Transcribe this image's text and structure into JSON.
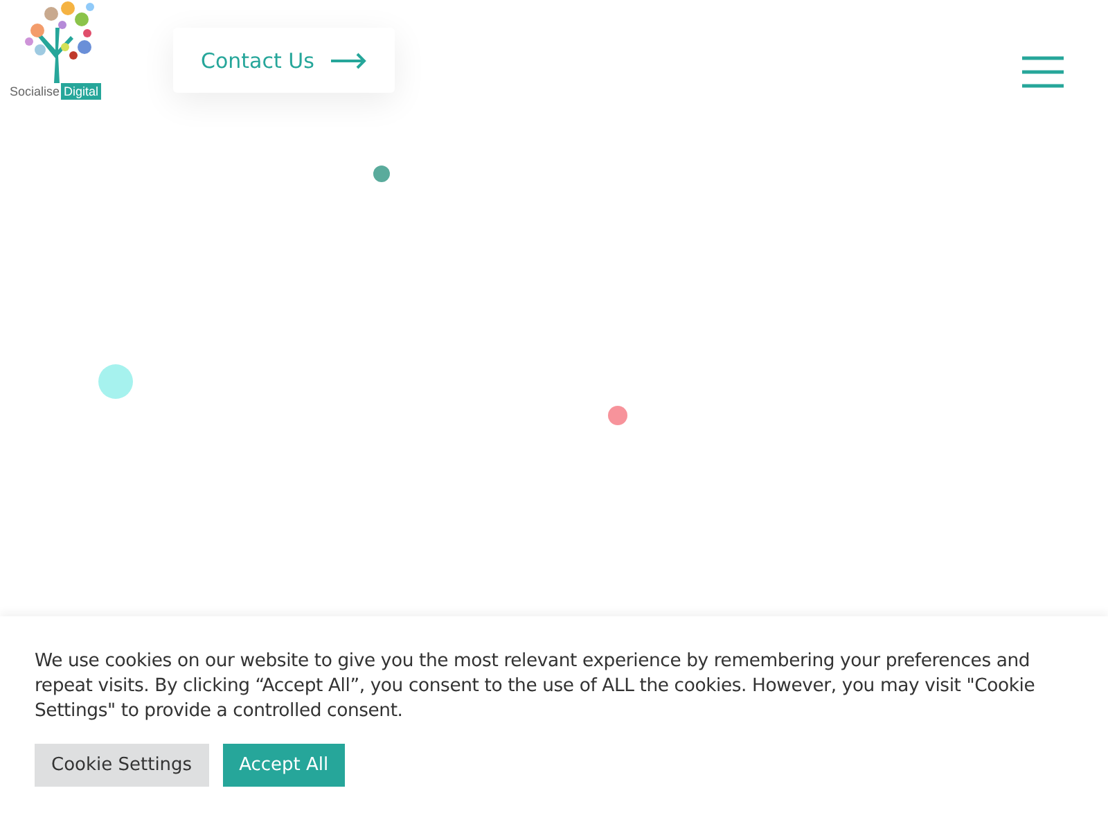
{
  "header": {
    "logo": {
      "word_1": "Socialise",
      "word_2": "Digital"
    },
    "contact_button": {
      "label": "Contact Us"
    }
  },
  "cookie_banner": {
    "message": "We use cookies on our website to give you the most relevant experience by remembering your preferences and repeat visits. By clicking “Accept All”, you consent to the use of ALL the cookies. However, you may visit \"Cookie Settings\" to provide a controlled consent.",
    "buttons": [
      {
        "label": "Cookie Settings",
        "kind": "secondary"
      },
      {
        "label": "Accept All",
        "kind": "primary"
      }
    ]
  }
}
